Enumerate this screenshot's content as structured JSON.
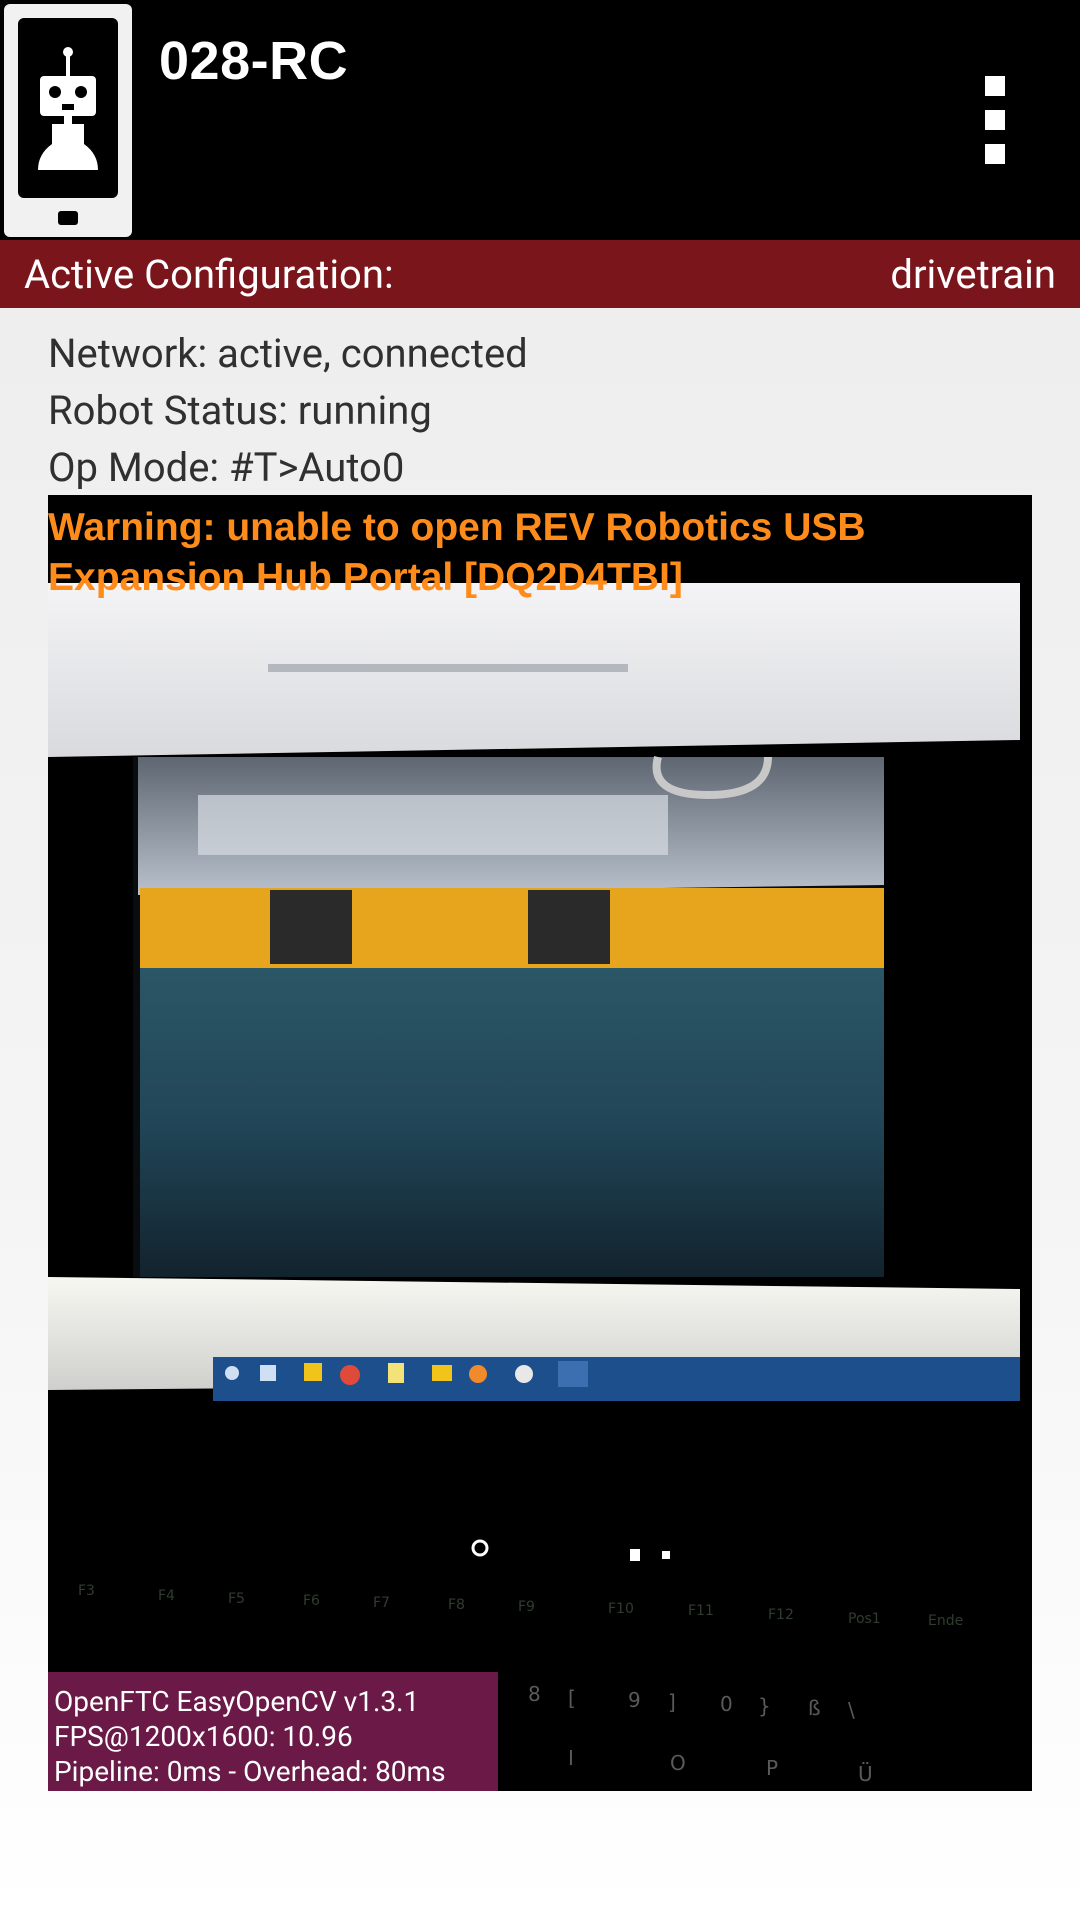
{
  "appbar": {
    "title": "028-RC",
    "app_icon": "robot-phone-icon",
    "menu_icon": "overflow-menu-icon"
  },
  "config": {
    "label": "Active Configuration:",
    "value": "drivetrain"
  },
  "status": {
    "network": "Network: active, connected",
    "robot": "Robot Status: running",
    "opmode": "Op Mode: #T>Auto0"
  },
  "camera": {
    "warning": "Warning: unable to open REV Robotics USB Expansion Hub Portal [DQ2D4TBI]",
    "stats": {
      "line1": "OpenFTC EasyOpenCV v1.3.1",
      "line2": "FPS@1200x1600: 10.96",
      "line3": "Pipeline: 0ms - Overhead: 80ms"
    }
  },
  "colors": {
    "appbar_bg": "#000000",
    "config_bar_bg": "#7a151b",
    "warning_text": "#ff8c1a",
    "stats_bg": "#6b1a48"
  }
}
